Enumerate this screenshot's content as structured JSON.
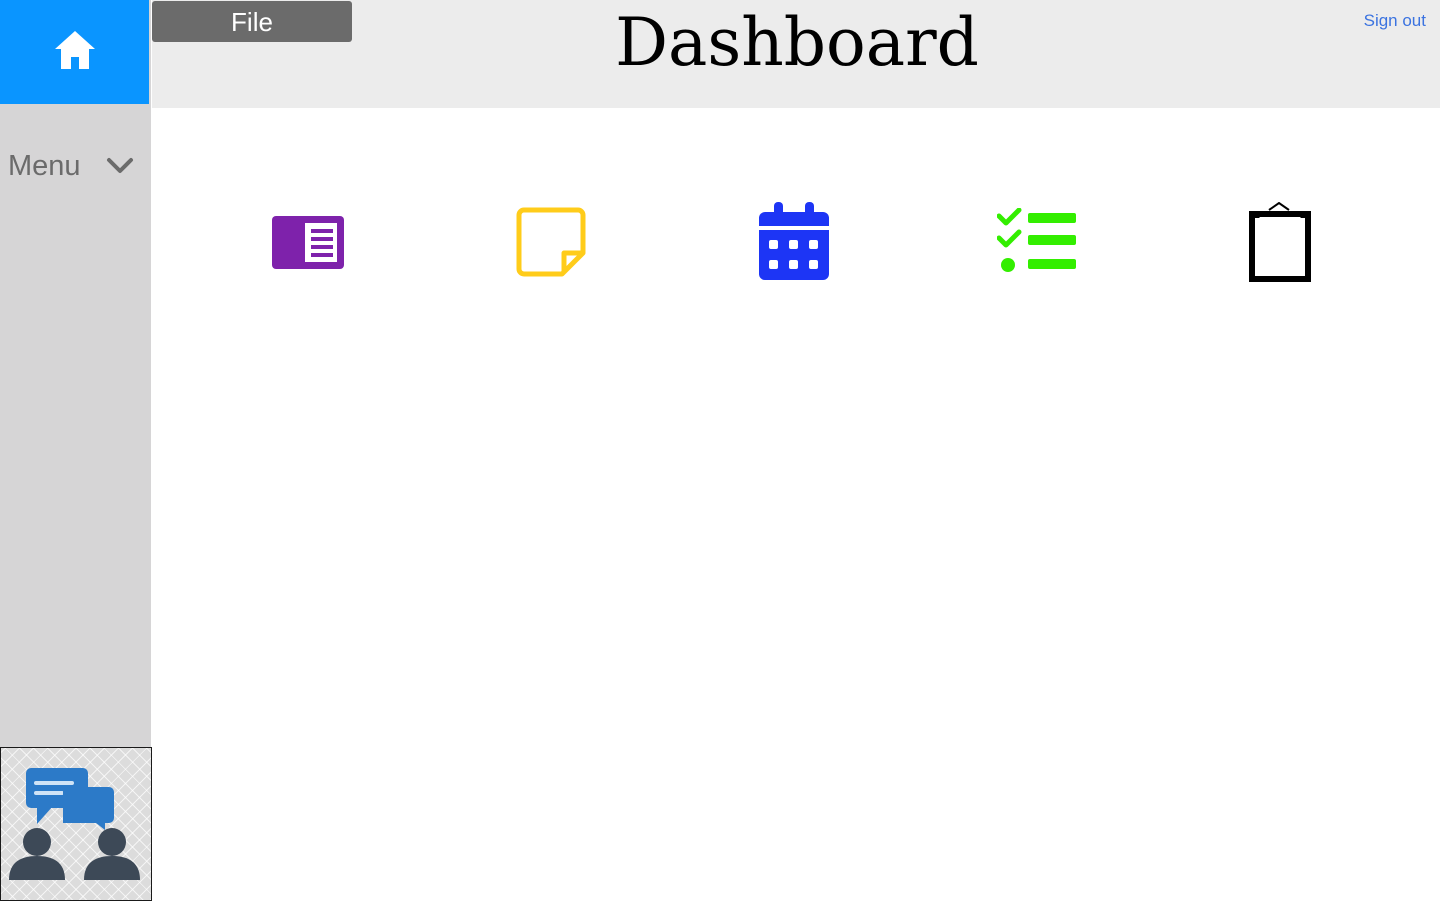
{
  "header": {
    "title": "Dashboard",
    "file_label": "File",
    "signout_label": "Sign out"
  },
  "sidebar": {
    "home_icon": "home-icon",
    "menu_label": "Menu",
    "menu_icon": "chevron-down-icon",
    "footer_icon": "chat-users-icon"
  },
  "apps": [
    {
      "icon": "reader-icon",
      "color": "#7e22ab"
    },
    {
      "icon": "sticky-note-icon",
      "color": "#ffcc1a"
    },
    {
      "icon": "calendar-icon",
      "color": "#1d35f5"
    },
    {
      "icon": "checklist-icon",
      "color": "#33ee00"
    },
    {
      "icon": "clipboard-icon",
      "color": "#000000"
    }
  ],
  "colors": {
    "accent": "#0a95ff",
    "link": "#3b73e0",
    "sidebar_bg": "#d6d5d6",
    "topbar_bg": "#ececec"
  }
}
